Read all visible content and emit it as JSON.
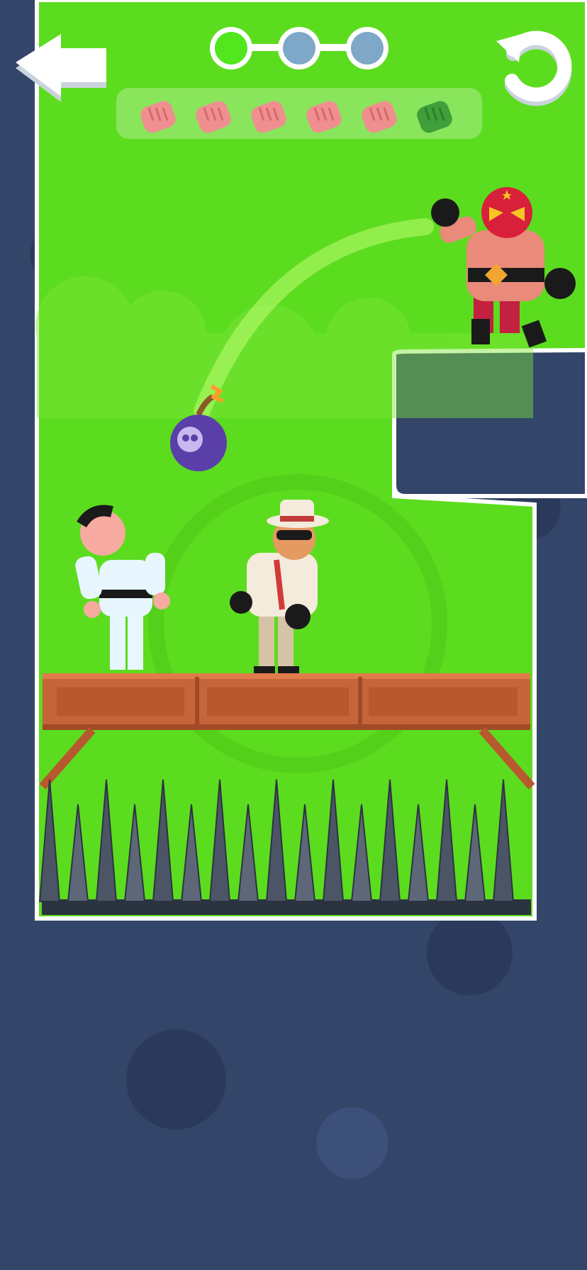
{
  "hud": {
    "back_icon": "arrow-left-icon",
    "restart_icon": "restart-icon",
    "level_progress": {
      "total": 3,
      "completed": 1
    },
    "punches": {
      "total": 6,
      "remaining": 5
    }
  },
  "scene": {
    "characters": [
      {
        "name": "karate-fighter"
      },
      {
        "name": "mafia-boss"
      },
      {
        "name": "luchador-wrestler"
      }
    ],
    "hazard": "spike-pit",
    "projectile": "bomb-skull-icon"
  },
  "colors": {
    "grass": "#5cdc1e",
    "rock": "#34456a",
    "progress_done": "#52e61e",
    "progress_todo": "#7ea7c8",
    "wood": "#c6643a"
  }
}
